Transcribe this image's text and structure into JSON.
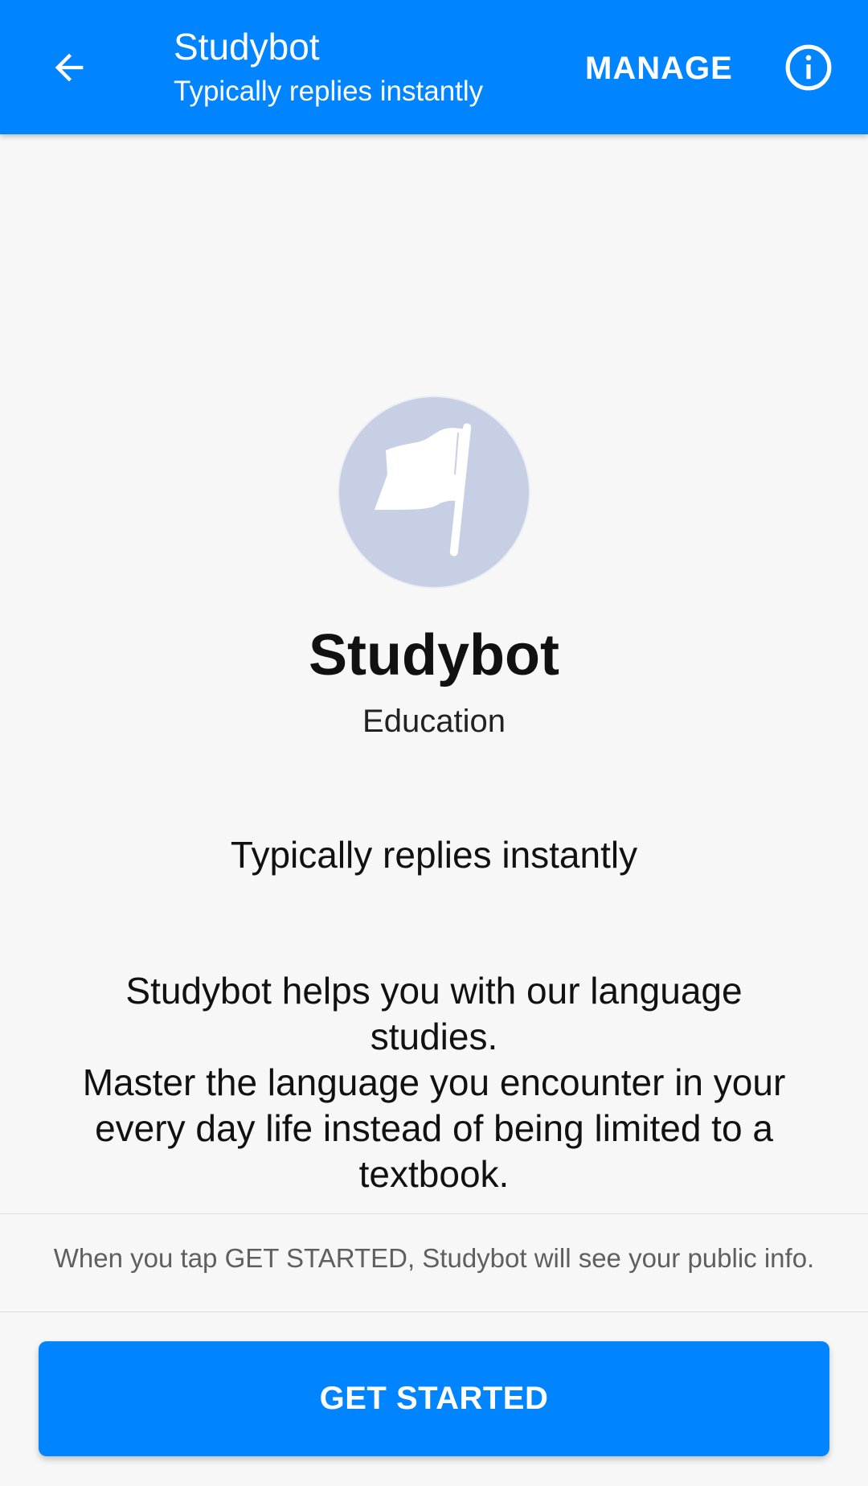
{
  "colors": {
    "accent": "#0084ff",
    "avatar_bg": "#c7cfe4",
    "page_bg": "#f7f7f7"
  },
  "header": {
    "back_icon": "arrow-left-icon",
    "title": "Studybot",
    "subtitle": "Typically replies instantly",
    "manage_label": "MANAGE",
    "info_icon": "info-circle-icon"
  },
  "profile": {
    "avatar_icon": "flag-icon",
    "name": "Studybot",
    "category": "Education",
    "response_time": "Typically replies instantly",
    "description": "Studybot helps you with our language\nstudies.\nMaster the language you encounter in your\nevery day life instead of being limited to a\ntextbook."
  },
  "footer": {
    "notice": "When you tap GET STARTED, Studybot will see your public info.",
    "cta_label": "GET STARTED"
  }
}
